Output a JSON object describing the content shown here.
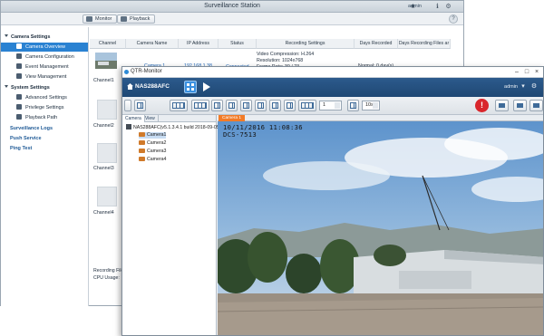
{
  "surveillance": {
    "title": "Surveillance Station",
    "user": "admin",
    "toolbar": {
      "monitor": "Monitor",
      "playback": "Playback"
    },
    "sidebar": {
      "camera_settings": "Camera Settings",
      "camera_overview": "Camera Overview",
      "camera_configuration": "Camera Configuration",
      "event_management": "Event Management",
      "view_management": "View Management",
      "system_settings": "System Settings",
      "advanced_settings": "Advanced Settings",
      "privilege_settings": "Privilege Settings",
      "playback_path": "Playback Path",
      "surveillance_logs": "Surveillance Logs",
      "push_service": "Push Service",
      "ping_test": "Ping Test"
    },
    "table": {
      "headers": [
        "Channel",
        "Camera Name",
        "IP Address",
        "Status",
        "Recording Settings",
        "Days Recorded",
        "Days Recording Files ar"
      ],
      "row1": {
        "camera_name": "Camera 1",
        "ip": "192.168.1.38",
        "status": "Connected",
        "rec_line1": "Video Compression: H.264",
        "rec_line2": "Resolution: 1024x768",
        "rec_line3": "Frame Rate: 30 / 23",
        "days": "Normal: 0 day(s)"
      },
      "channels": [
        "Channel1",
        "Channel2",
        "Channel3",
        "Channel4"
      ]
    },
    "footer": {
      "recording_file": "Recording File S",
      "cpu_usage": "CPU Usage:"
    }
  },
  "monitor": {
    "title": "QTR-Monitor",
    "nas_name": "NAS288AFC",
    "user": "admin",
    "toolbar": {
      "channel_value": "1",
      "zoom_value": "10s"
    },
    "tabs": {
      "camera": "Camera",
      "view": "View"
    },
    "tree": {
      "root": "NAS288AFC(v5.1.3.4.1 build 2018-09-05",
      "cameras": [
        "Camera1",
        "Camera2",
        "Camera3",
        "Camera4"
      ]
    },
    "view_tab": "Camera 1",
    "osd": {
      "timestamp": "10/11/2016 11:08:36",
      "camera_id": "DCS-7513"
    }
  }
}
